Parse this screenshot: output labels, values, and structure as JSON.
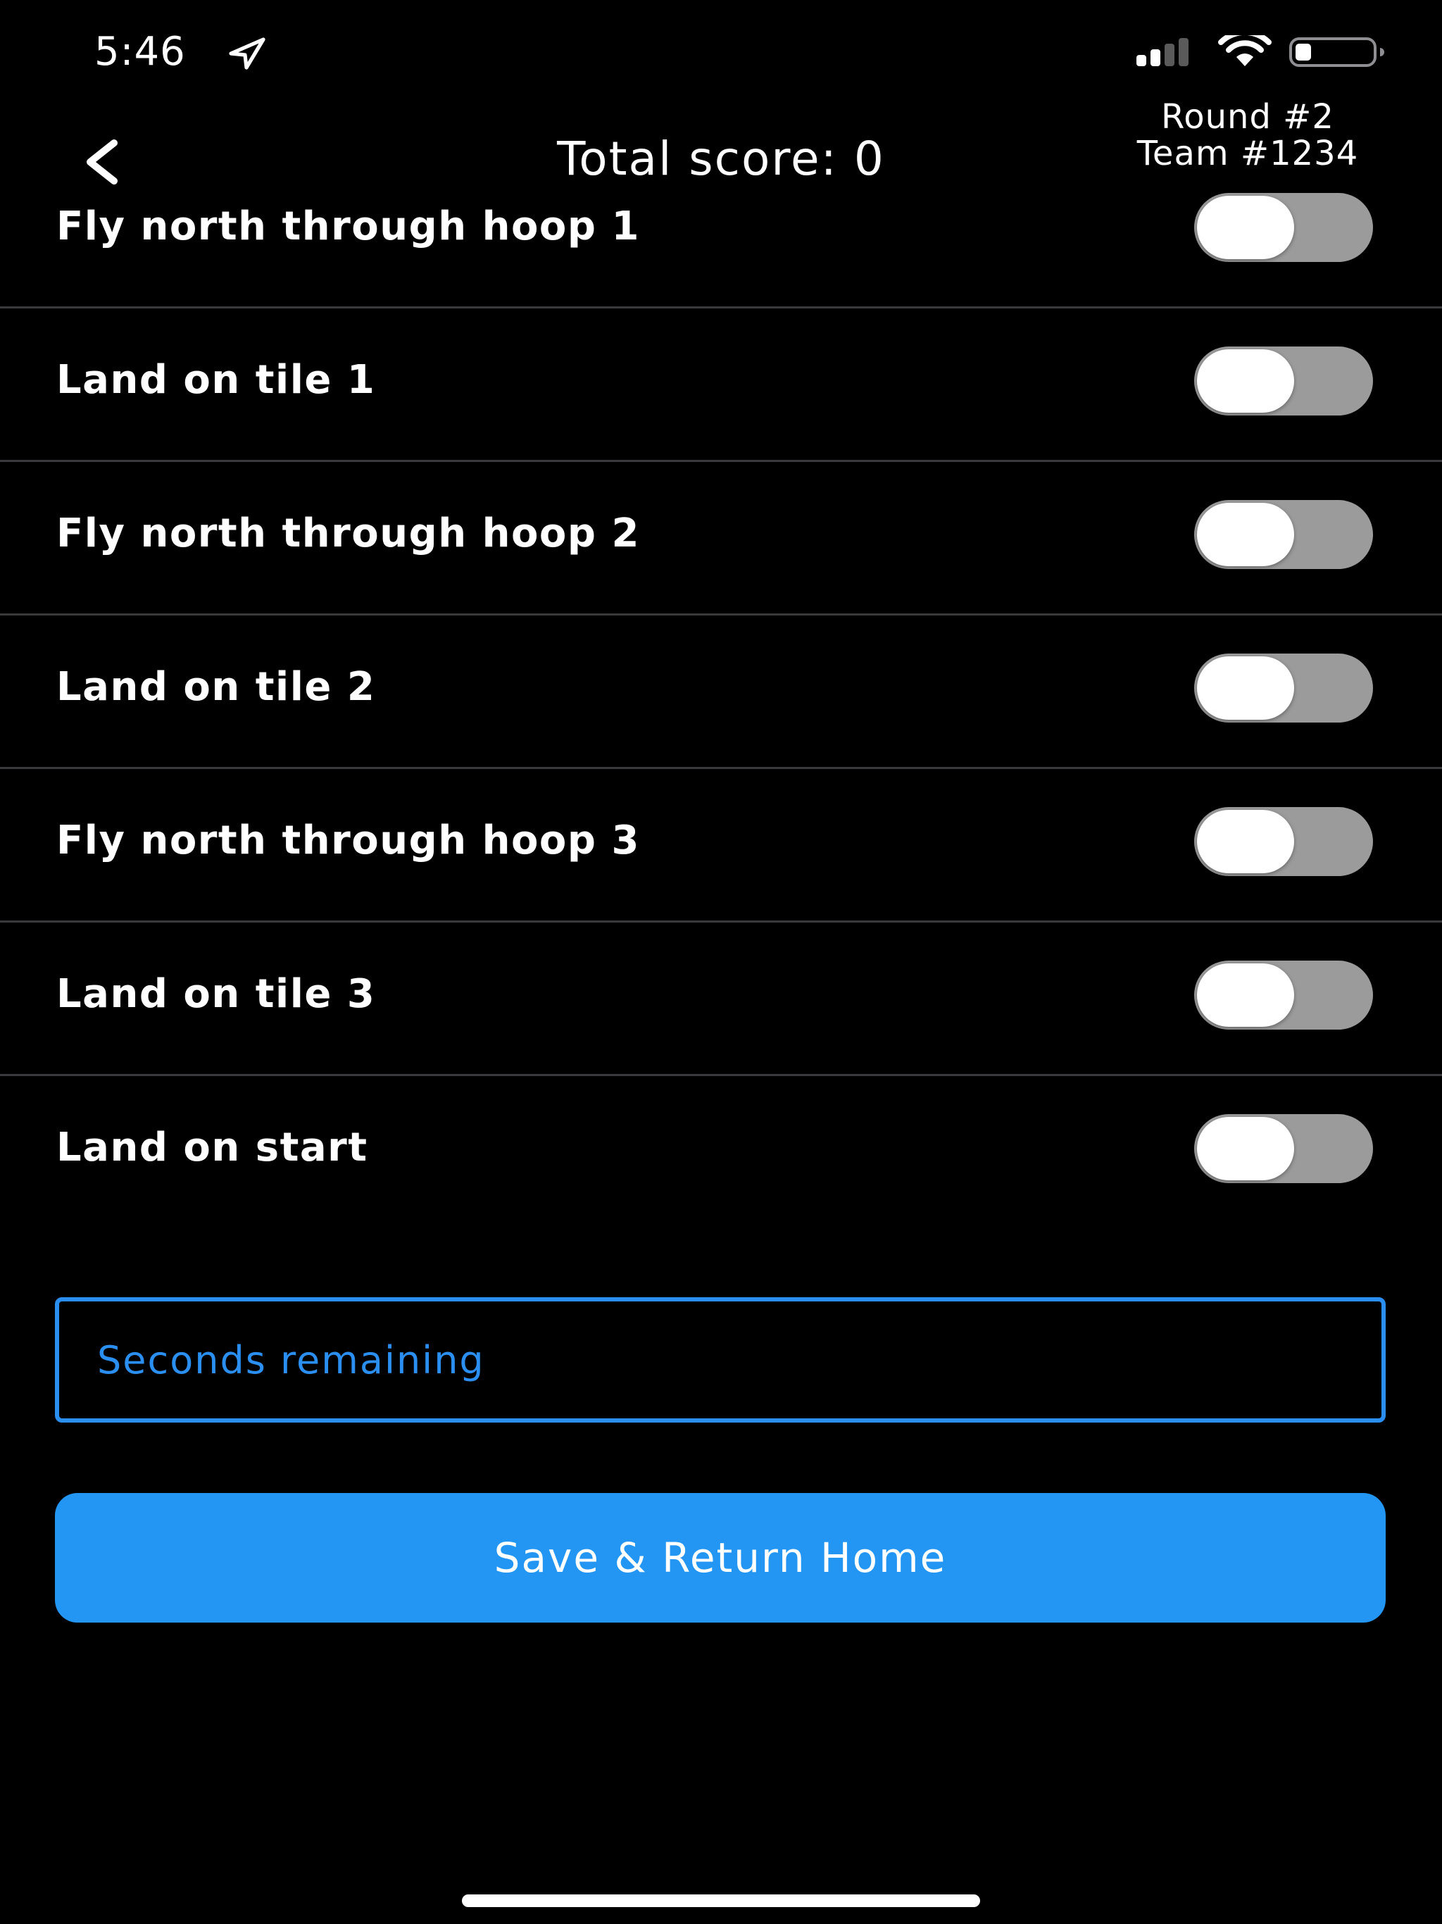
{
  "status_bar": {
    "time": "5:46",
    "icons": [
      "location-arrow-icon",
      "cellular-signal-icon",
      "wifi-icon",
      "battery-icon"
    ]
  },
  "header": {
    "back_icon": "chevron-left-icon",
    "title": "Total score: 0",
    "round": "Round #2",
    "team": "Team #1234"
  },
  "tasks": [
    {
      "label": "Fly north through hoop 1",
      "enabled": false
    },
    {
      "label": "Land on tile 1",
      "enabled": false
    },
    {
      "label": "Fly north through hoop 2",
      "enabled": false
    },
    {
      "label": "Land on tile 2",
      "enabled": false
    },
    {
      "label": "Fly north through hoop 3",
      "enabled": false
    },
    {
      "label": "Land on tile 3",
      "enabled": false
    },
    {
      "label": "Land on start",
      "enabled": false
    }
  ],
  "seconds_input": {
    "placeholder": "Seconds remaining",
    "value": ""
  },
  "save_button": {
    "label": "Save & Return Home"
  },
  "colors": {
    "background": "#000000",
    "text": "#ffffff",
    "accent": "#2396f3",
    "input_border": "#2a8ff0",
    "toggle_off_track": "#9b9b9b",
    "separator": "#3a3a3c"
  }
}
